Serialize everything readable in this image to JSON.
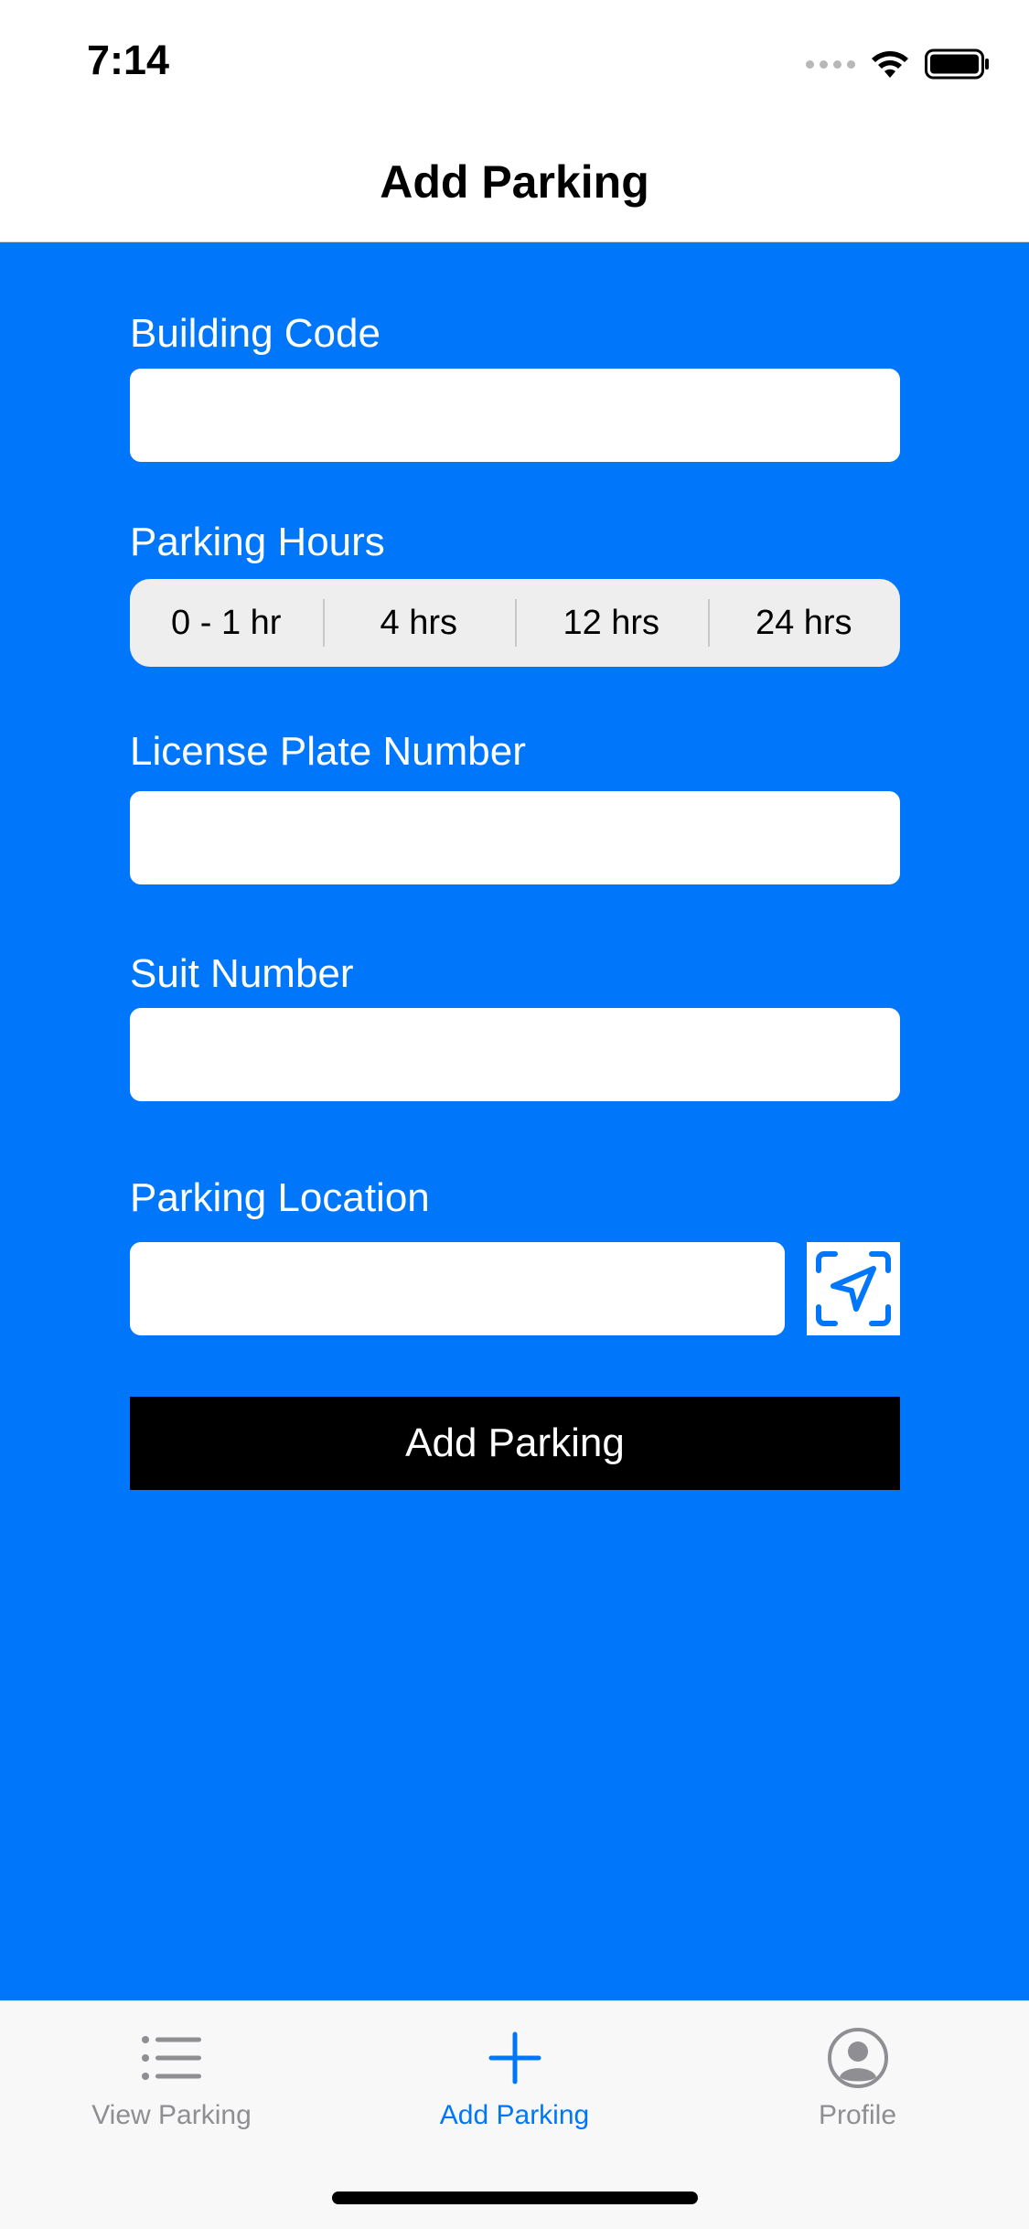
{
  "status_bar": {
    "time": "7:14"
  },
  "nav": {
    "title": "Add Parking"
  },
  "form": {
    "building_code": {
      "label": "Building Code",
      "value": "",
      "placeholder": ""
    },
    "parking_hours": {
      "label": "Parking Hours",
      "options": [
        "0 - 1 hr",
        "4 hrs",
        "12 hrs",
        "24 hrs"
      ]
    },
    "license_plate": {
      "label": "License Plate Number",
      "value": "",
      "placeholder": ""
    },
    "suit_number": {
      "label": "Suit Number",
      "value": "",
      "placeholder": ""
    },
    "parking_location": {
      "label": "Parking Location",
      "value": "",
      "placeholder": "",
      "button_icon": "location-arrow-icon"
    },
    "submit_label": "Add Parking"
  },
  "tab_bar": {
    "items": [
      {
        "label": "View Parking",
        "icon": "list-icon",
        "active": false
      },
      {
        "label": "Add Parking",
        "icon": "plus-icon",
        "active": true
      },
      {
        "label": "Profile",
        "icon": "person-circle-icon",
        "active": false
      }
    ]
  },
  "colors": {
    "accent": "#0077FB",
    "content_background": "#0077FB",
    "button_background": "#000000",
    "tab_inactive": "#8e8e93"
  }
}
